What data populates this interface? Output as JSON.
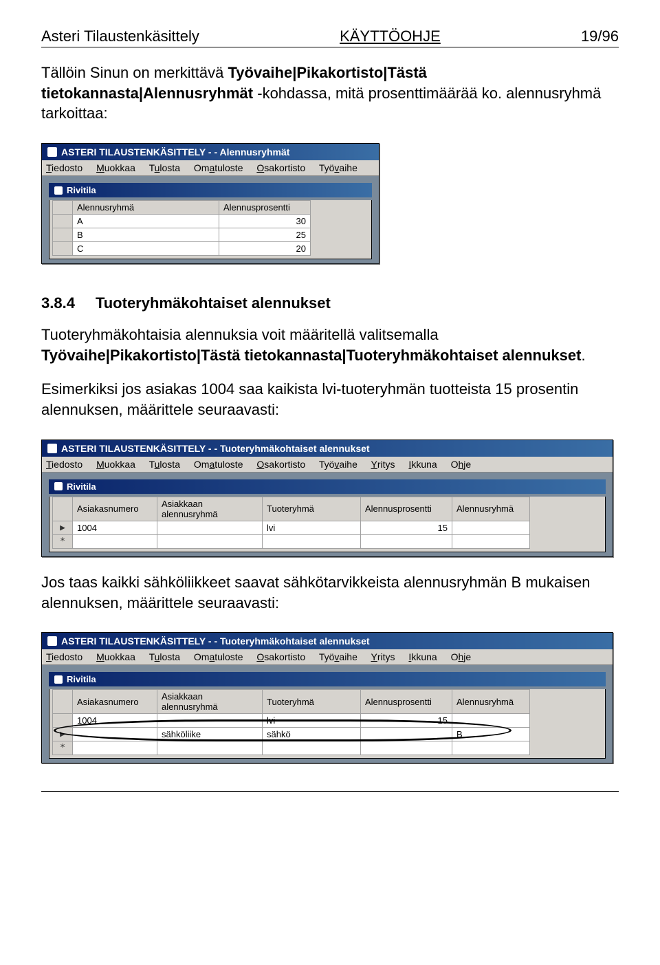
{
  "header": {
    "left": "Asteri Tilaustenkäsittely",
    "center": "KÄYTTÖOHJE",
    "right": "19/96"
  },
  "para1a": "Tällöin Sinun on merkittävä ",
  "para1b": "Työvaihe|Pikakortisto|Tästä tietokannasta|Alennusryhmät",
  "para1c": " -kohdassa, mitä prosenttimäärää ko. alennusryhmä tarkoittaa:",
  "win1": {
    "title": "ASTERI TILAUSTENKÄSITTELY -  - Alennusryhmät",
    "menus": [
      "Tiedosto",
      "Muokkaa",
      "Tulosta",
      "Omatuloste",
      "Osakortisto",
      "Työvaihe"
    ],
    "child_title": "Rivitila",
    "columns": [
      "Alennusryhmä",
      "Alennusprosentti"
    ],
    "rows": [
      {
        "r": "A",
        "p": "30"
      },
      {
        "r": "B",
        "p": "25"
      },
      {
        "r": "C",
        "p": "20"
      }
    ]
  },
  "section": {
    "num": "3.8.4",
    "title": "Tuoteryhmäkohtaiset alennukset"
  },
  "para2a": "Tuoteryhmäkohtaisia alennuksia voit määritellä valitsemalla ",
  "para2b": "Työvaihe|Pikakortisto|Tästä tietokannasta|Tuoteryhmäkohtaiset alennukset",
  "para2c": ".",
  "para3": "Esimerkiksi jos asiakas 1004 saa kaikista lvi-tuoteryhmän tuotteista 15 prosentin alennuksen, määrittele seuraavasti:",
  "win2": {
    "title": "ASTERI TILAUSTENKÄSITTELY -  - Tuoteryhmäkohtaiset alennukset",
    "menus": [
      "Tiedosto",
      "Muokkaa",
      "Tulosta",
      "Omatuloste",
      "Osakortisto",
      "Työvaihe",
      "Yritys",
      "Ikkuna",
      "Ohje"
    ],
    "child_title": "Rivitila",
    "columns": [
      "Asiakasnumero",
      "Asiakkaan alennusryhmä",
      "Tuoteryhmä",
      "Alennusprosentti",
      "Alennusryhmä"
    ],
    "rows": [
      {
        "a": "1004",
        "b": "",
        "c": "lvi",
        "d": "15",
        "e": ""
      }
    ]
  },
  "para4": "Jos taas kaikki sähköliikkeet saavat sähkötarvikkeista alennusryhmän B mukaisen alennuksen, määrittele seuraavasti:",
  "win3": {
    "title": "ASTERI TILAUSTENKÄSITTELY -  - Tuoteryhmäkohtaiset alennukset",
    "menus": [
      "Tiedosto",
      "Muokkaa",
      "Tulosta",
      "Omatuloste",
      "Osakortisto",
      "Työvaihe",
      "Yritys",
      "Ikkuna",
      "Ohje"
    ],
    "child_title": "Rivitila",
    "columns": [
      "Asiakasnumero",
      "Asiakkaan alennusryhmä",
      "Tuoteryhmä",
      "Alennusprosentti",
      "Alennusryhmä"
    ],
    "rows": [
      {
        "a": "1004",
        "b": "",
        "c": "lvi",
        "d": "15",
        "e": ""
      },
      {
        "a": "",
        "b": "sähköliike",
        "c": "sähkö",
        "d": "",
        "e": "B"
      }
    ]
  },
  "star": "*",
  "arrow": "▶"
}
